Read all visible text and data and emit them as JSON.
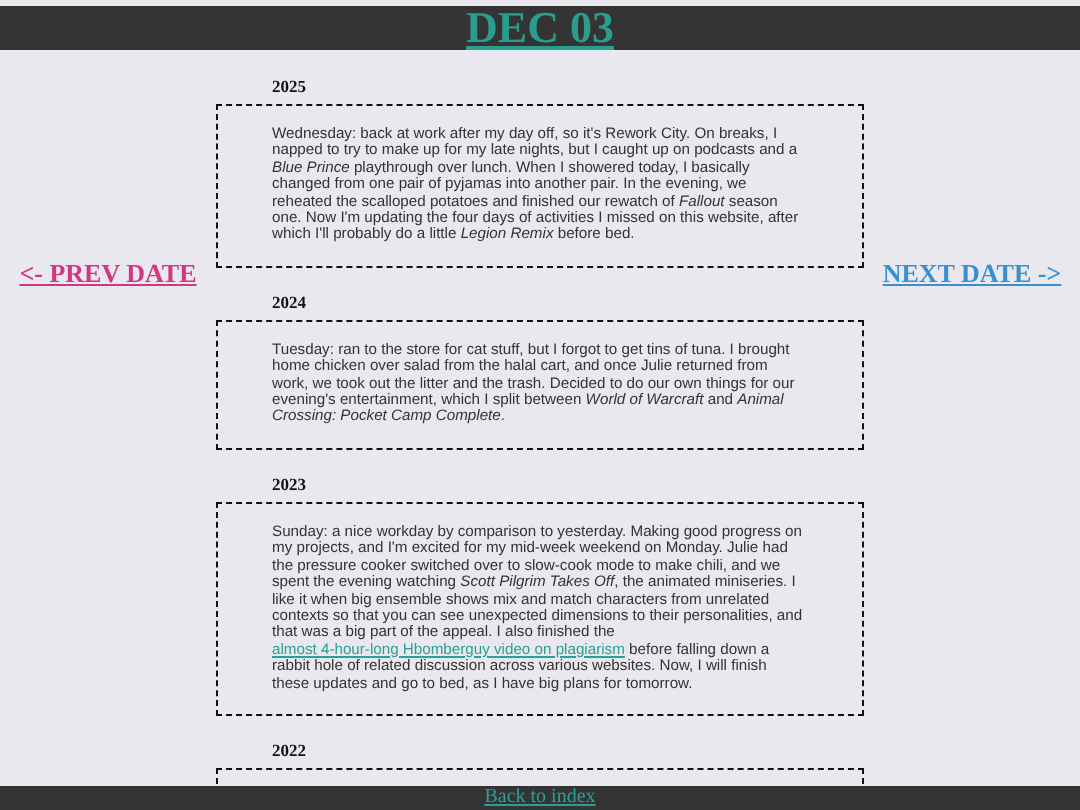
{
  "title": "DEC 03",
  "prev_link": "<- PREV DATE",
  "next_link": "NEXT DATE ->",
  "entries": [
    {
      "year": "2025",
      "text": "Wednesday: back at work after my day off, so it's Rework City. On breaks, I napped to try to make up for my late nights, but I caught up on podcasts and a *Blue Prince* playthrough over lunch. When I showered today, I basically changed from one pair of pyjamas into another pair. In the evening, we reheated the scalloped potatoes and finished our rewatch of *Fallout* season one. Now I'm updating the four days of activities I missed on this website, after which I'll probably do a little *Legion Remix* before bed."
    },
    {
      "year": "2024",
      "text": "Tuesday: ran to the store for cat stuff, but I forgot to get tins of tuna. I brought home chicken over salad from the halal cart, and once Julie returned from work, we took out the litter and the trash. Decided to do our own things for our evening's entertainment, which I split between *World of Warcraft* and *Animal Crossing: Pocket Camp Complete*."
    },
    {
      "year": "2023",
      "text": "Sunday: a nice workday by comparison to yesterday. Making good progress on my projects, and I'm excited for my mid-week weekend on Monday. Julie had the pressure cooker switched over to slow-cook mode to make chili, and we spent the evening watching *Scott Pilgrim Takes Off*, the animated miniseries. I like it when big ensemble shows mix and match characters from unrelated contexts so that you can see unexpected dimensions to their personalities, and that was a big part of the appeal. I also finished the",
      "link": "almost 4-hour-long Hbomberguy video on plagiarism",
      "text_after": "before falling down a rabbit hole of related discussion across various websites. Now, I will finish these updates and go to bed, as I have big plans for tomorrow."
    },
    {
      "year": "2022"
    }
  ],
  "footer_link": "Back to index"
}
